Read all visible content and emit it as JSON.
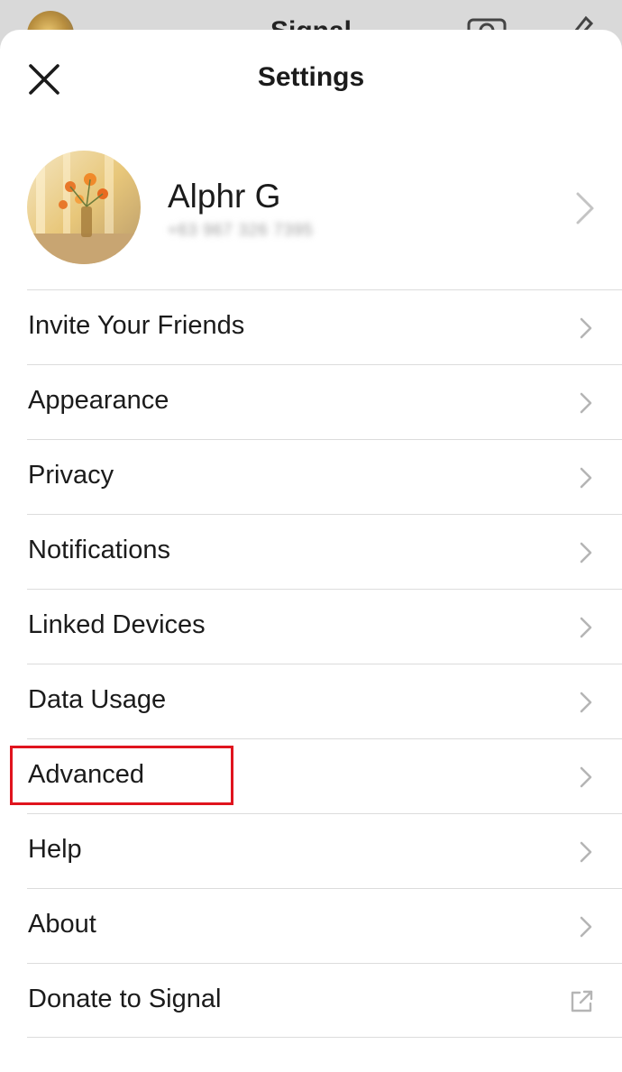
{
  "background_app": {
    "title": "Signal"
  },
  "sheet": {
    "title": "Settings",
    "close_icon": "close-icon"
  },
  "profile": {
    "name": "Alphr G",
    "phone": "+63 967 326 7395"
  },
  "menu": {
    "items": [
      {
        "label": "Invite Your Friends",
        "icon": "chevron-right-icon"
      },
      {
        "label": "Appearance",
        "icon": "chevron-right-icon"
      },
      {
        "label": "Privacy",
        "icon": "chevron-right-icon"
      },
      {
        "label": "Notifications",
        "icon": "chevron-right-icon"
      },
      {
        "label": "Linked Devices",
        "icon": "chevron-right-icon"
      },
      {
        "label": "Data Usage",
        "icon": "chevron-right-icon"
      },
      {
        "label": "Advanced",
        "icon": "chevron-right-icon"
      },
      {
        "label": "Help",
        "icon": "chevron-right-icon"
      },
      {
        "label": "About",
        "icon": "chevron-right-icon"
      },
      {
        "label": "Donate to Signal",
        "icon": "external-link-icon"
      }
    ]
  },
  "colors": {
    "highlight": "#e0141e",
    "text": "#1b1b1b",
    "chevron": "#b5b5b5",
    "divider": "#dcdcdc"
  }
}
